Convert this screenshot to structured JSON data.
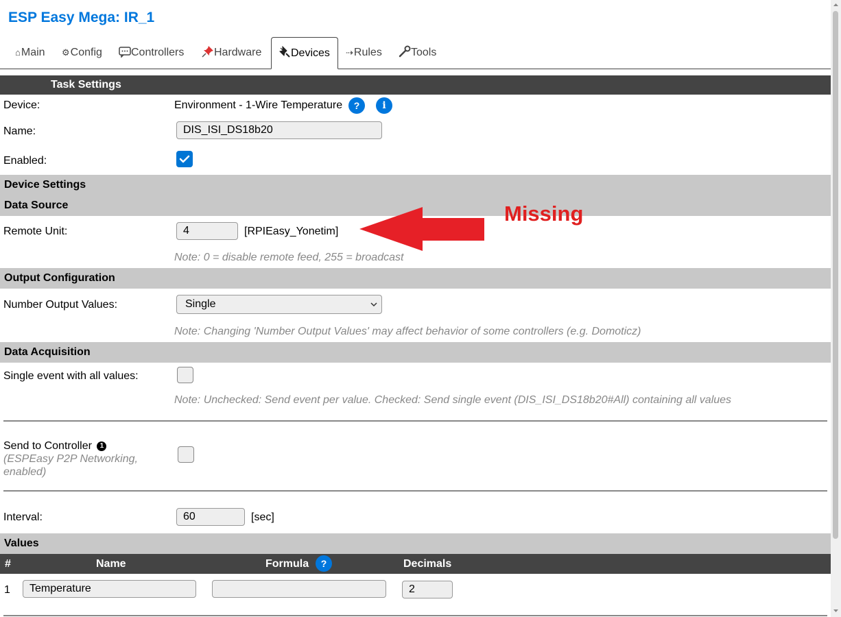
{
  "app": {
    "title": "ESP Easy Mega: IR_1"
  },
  "tabs": [
    {
      "icon": "⌂",
      "label": "Main"
    },
    {
      "icon": "⚙",
      "label": "Config"
    },
    {
      "icon": "",
      "label": "Controllers"
    },
    {
      "icon": "",
      "label": "Hardware"
    },
    {
      "icon": "",
      "label": "Devices"
    },
    {
      "icon": "⇢",
      "label": "Rules"
    },
    {
      "icon": "",
      "label": "Tools"
    }
  ],
  "task_settings": {
    "header": "Task Settings",
    "device_label": "Device:",
    "device_value": "Environment - 1-Wire Temperature",
    "help_q": "?",
    "help_i": "i",
    "name_label": "Name:",
    "name_value": "DIS_ISI_DS18b20",
    "enabled_label": "Enabled:"
  },
  "device_settings": {
    "header": "Device Settings"
  },
  "data_source": {
    "header": "Data Source",
    "remote_unit_label": "Remote Unit:",
    "remote_unit_value": "4",
    "remote_unit_name": "[RPIEasy_Yonetim]",
    "note": "Note: 0 = disable remote feed, 255 = broadcast"
  },
  "annotation": {
    "text": "Missing",
    "color": "#e02020"
  },
  "output_configuration": {
    "header": "Output Configuration",
    "label": "Number Output Values:",
    "selected": "Single",
    "note": "Note: Changing 'Number Output Values' may affect behavior of some controllers (e.g. Domoticz)"
  },
  "data_acquisition": {
    "header": "Data Acquisition",
    "single_event_label": "Single event with all values:",
    "note": "Note: Unchecked: Send event per value. Checked: Send single event (DIS_ISI_DS18b20#All) containing all values",
    "send_controller_label": "Send to Controller",
    "send_controller_badge": "1",
    "send_controller_sub": "(ESPEasy P2P Networking, enabled)",
    "interval_label": "Interval:",
    "interval_value": "60",
    "interval_unit": "[sec]"
  },
  "values": {
    "header": "Values",
    "col_num": "#",
    "col_name": "Name",
    "col_formula": "Formula",
    "col_formula_help": "?",
    "col_decimals": "Decimals",
    "rows": [
      {
        "num": "1",
        "name": "Temperature",
        "formula": "",
        "decimals": "2"
      }
    ]
  },
  "colors": {
    "accent": "#0077dd",
    "header_dark": "#444444",
    "section_grey": "#c8c8c8"
  }
}
